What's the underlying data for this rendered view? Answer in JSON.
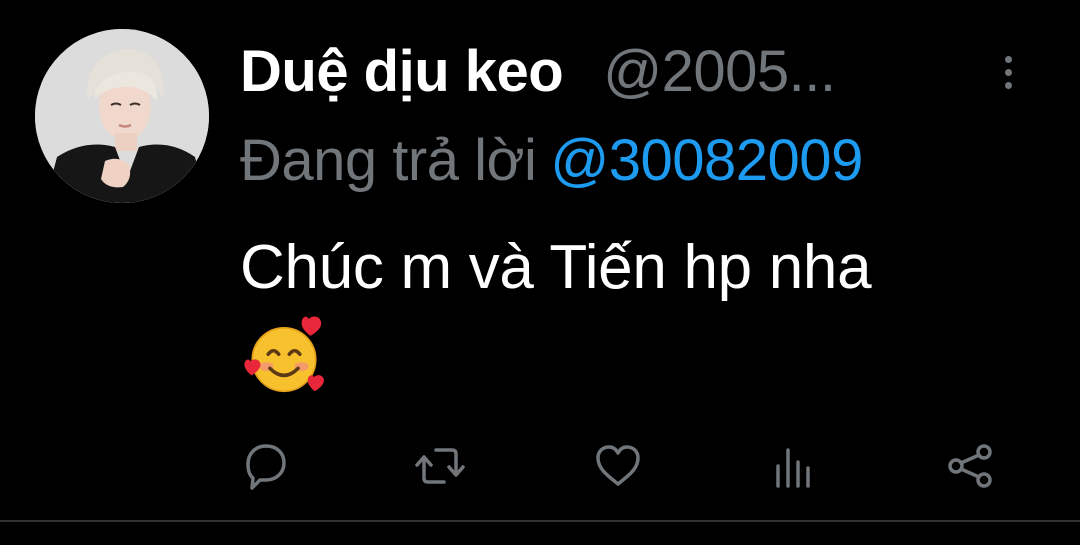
{
  "tweet": {
    "display_name": "Duệ dịu keo",
    "handle": "@2005...",
    "replying_to_prefix": "Đang trả lời",
    "replying_to_handle": "@30082009",
    "text": "Chúc m và Tiến hp nha",
    "emoji": "smiling-face-with-hearts"
  },
  "actions": {
    "reply": "reply-icon",
    "retweet": "retweet-icon",
    "like": "heart-icon",
    "views": "analytics-icon",
    "share": "share-icon"
  },
  "colors": {
    "background": "#000000",
    "primary_text": "#ffffff",
    "secondary_text": "#71767b",
    "accent": "#1d9bf0",
    "divider": "#2f3336"
  }
}
